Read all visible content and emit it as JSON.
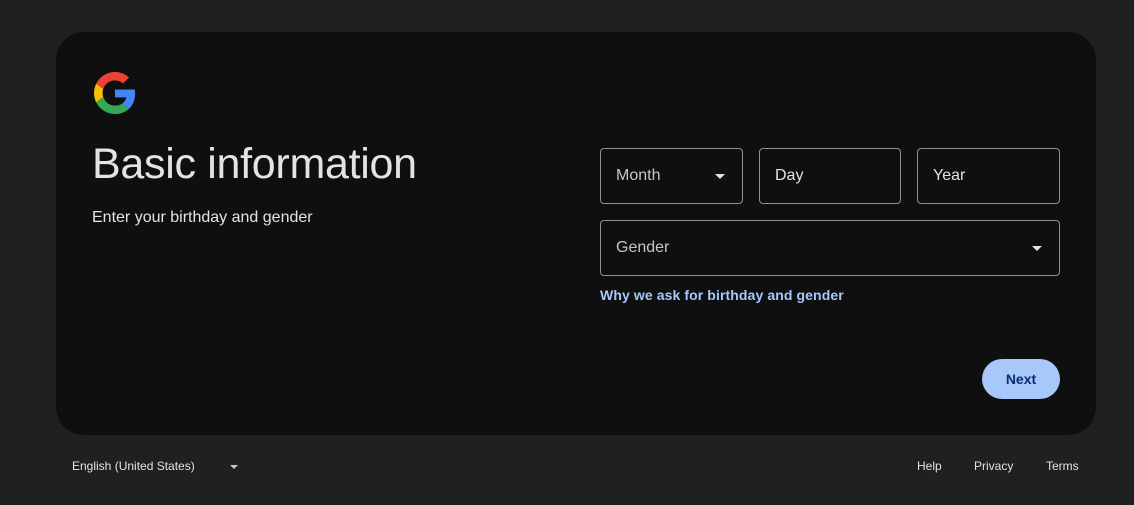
{
  "header": {
    "logo_icon": "google-g-logo",
    "title": "Basic information",
    "subtitle": "Enter your birthday and gender"
  },
  "form": {
    "month": {
      "label": "Month",
      "icon": "dropdown-arrow-icon"
    },
    "day": {
      "label": "Day"
    },
    "year": {
      "label": "Year"
    },
    "gender": {
      "label": "Gender",
      "icon": "dropdown-arrow-icon"
    },
    "why_link": "Why we ask for birthday and gender",
    "next_label": "Next"
  },
  "footer": {
    "language": "English (United States)",
    "links": {
      "help": "Help",
      "privacy": "Privacy",
      "terms": "Terms"
    }
  },
  "colors": {
    "page_bg": "#1f2020",
    "card_bg": "#0f0f0f",
    "accent": "#a8c7fa",
    "button_text": "#062e6f",
    "google_blue": "#4285F4",
    "google_red": "#EA4335",
    "google_yellow": "#FBBC05",
    "google_green": "#34A853"
  }
}
